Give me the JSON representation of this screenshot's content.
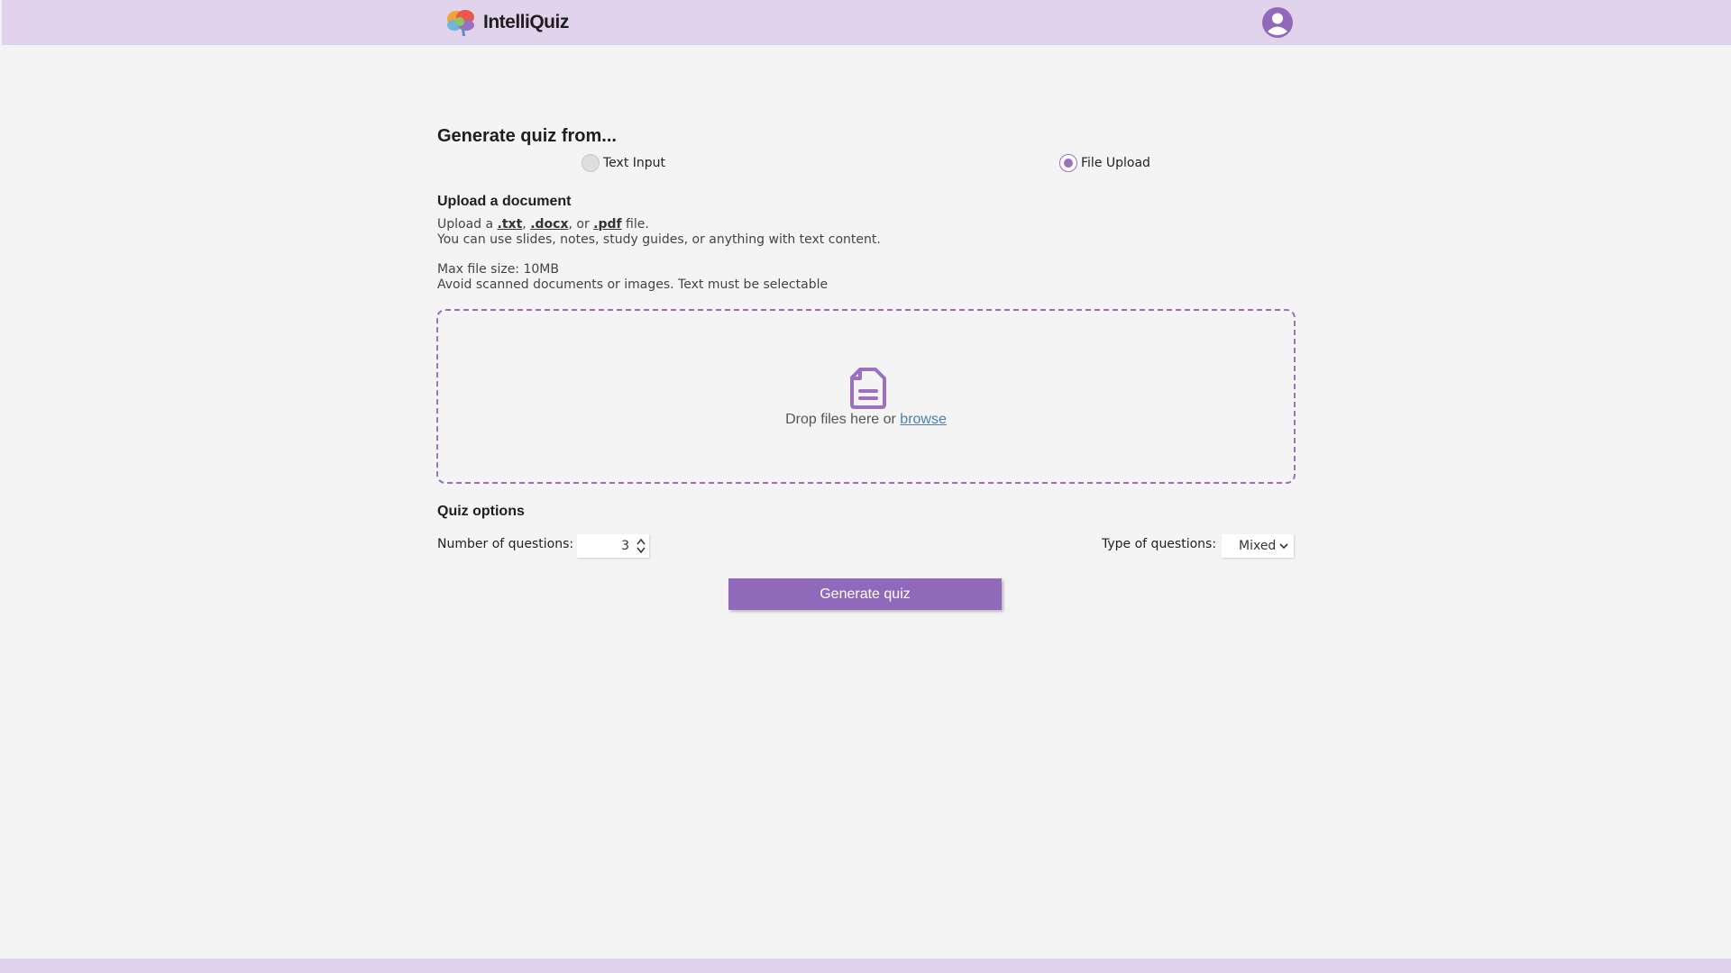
{
  "header": {
    "app_name": "IntelliQuiz",
    "logo_icon": "brain-icon",
    "profile_icon": "user-avatar-icon"
  },
  "source": {
    "heading": "Generate quiz from...",
    "options": [
      {
        "label": "Text Input",
        "selected": false
      },
      {
        "label": "File Upload",
        "selected": true
      }
    ]
  },
  "upload": {
    "heading": "Upload a document",
    "line1_prefix": "Upload a ",
    "ext_txt": ".txt",
    "sep1": ", ",
    "ext_docx": ".docx",
    "sep2": ", or ",
    "ext_pdf": ".pdf",
    "line1_suffix": " file.",
    "line2": "You can use slides, notes, study guides, or anything with text content.",
    "line3": "Max file size: 10MB",
    "line4": "Avoid scanned documents or images. Text must be selectable",
    "drop_text": "Drop files here or ",
    "browse_label": "browse",
    "drop_icon": "document-icon"
  },
  "options": {
    "heading": "Quiz options",
    "num_label": "Number of questions:",
    "num_value": "3",
    "type_label": "Type of questions:",
    "type_value": "Mixed"
  },
  "generate_label": "Generate quiz",
  "colors": {
    "accent": "#9169ba",
    "topbar": "#e1d3ec",
    "background": "#f4f4f4",
    "link": "#4a7fae"
  }
}
